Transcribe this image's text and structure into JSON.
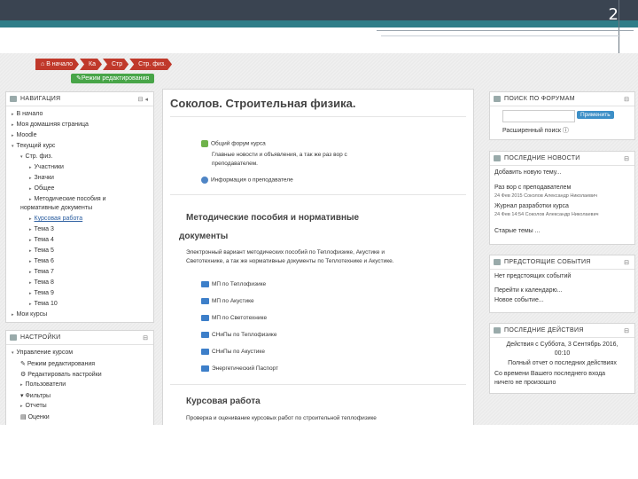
{
  "slide": {
    "number": "2"
  },
  "breadcrumb": [
    "В начало",
    "Ка",
    "Стр",
    "Стр. физ."
  ],
  "edit_button": "Режим редактирования",
  "nav_block": {
    "title": "НАВИГАЦИЯ",
    "items": [
      "В начало",
      "Моя домашняя страница",
      "Moodle",
      "Текущий курс",
      "Стр. физ.",
      "Участники",
      "Значки",
      "Общее",
      "Методические пособия и",
      "нормативные документы",
      "Курсовая работа",
      "Тема 3",
      "Тема 4",
      "Тема 5",
      "Тема 6",
      "Тема 7",
      "Тема 8",
      "Тема 9",
      "Тема 10",
      "Мои курсы"
    ]
  },
  "settings_block": {
    "title": "НАСТРОЙКИ",
    "items": [
      "Управление курсом",
      "Режим редактирования",
      "Редактировать настройки",
      "Пользователи",
      "Фильтры",
      "Отчеты",
      "Оценки"
    ]
  },
  "main": {
    "title": "Соколов. Строительная физика.",
    "forum_link": "Общий форум курса",
    "forum_desc_1": "Главные новости и объявления, а так же раз вор с",
    "forum_desc_2": "преподавателем.",
    "teacher_info": "Информация о преподавателе",
    "section1_title_1": "Методические пособия и нормативные",
    "section1_title_2": "документы",
    "section1_desc_1": "Электронный вариант методических пособий по Теплофизике, Акустике и",
    "section1_desc_2": "Светотехнике, а так же нормативные документы по Теплотехнике и Акустике.",
    "folders": [
      "МП по Теплофизике",
      "МП по Акустике",
      "МП по Светотехнике",
      "СНиПы по Теплофизике",
      "СНиПы по Акустике",
      "Энергетический Паспорт"
    ],
    "section2_title": "Курсовая работа",
    "section2_desc": "Проверка и оценивание курсовых работ по строительной теплофизике"
  },
  "search_block": {
    "title": "ПОИСК ПО ФОРУМАМ",
    "button": "Применить",
    "advanced": "Расширенный поиск"
  },
  "news_block": {
    "title": "ПОСЛЕДНИЕ НОВОСТИ",
    "add": "Добавить новую тему...",
    "item1_title": "Раз вор с преподавателем",
    "item1_meta": "24 Фев 2015 Соколов Александр Николаевич",
    "item2_title": "Журнал разработки курса",
    "item2_meta": "24 Фев 14:54 Соколов Александр Николаевич",
    "old": "Старые темы ..."
  },
  "events_block": {
    "title": "ПРЕДСТОЯЩИЕ СОБЫТИЯ",
    "none": "Нет предстоящих событий",
    "calendar": "Перейти к календарю...",
    "new_event": "Новое событие..."
  },
  "actions_block": {
    "title": "ПОСЛЕДНИЕ ДЕЙСТВИЯ",
    "since_1": "Действия с Суббота, 3 Сентябрь 2016,",
    "since_2": "00:10",
    "full_report": "Полный отчет о последних действиях",
    "last_1": "Со времени Вашего последнего входа",
    "last_2": "ничего не произошло"
  }
}
